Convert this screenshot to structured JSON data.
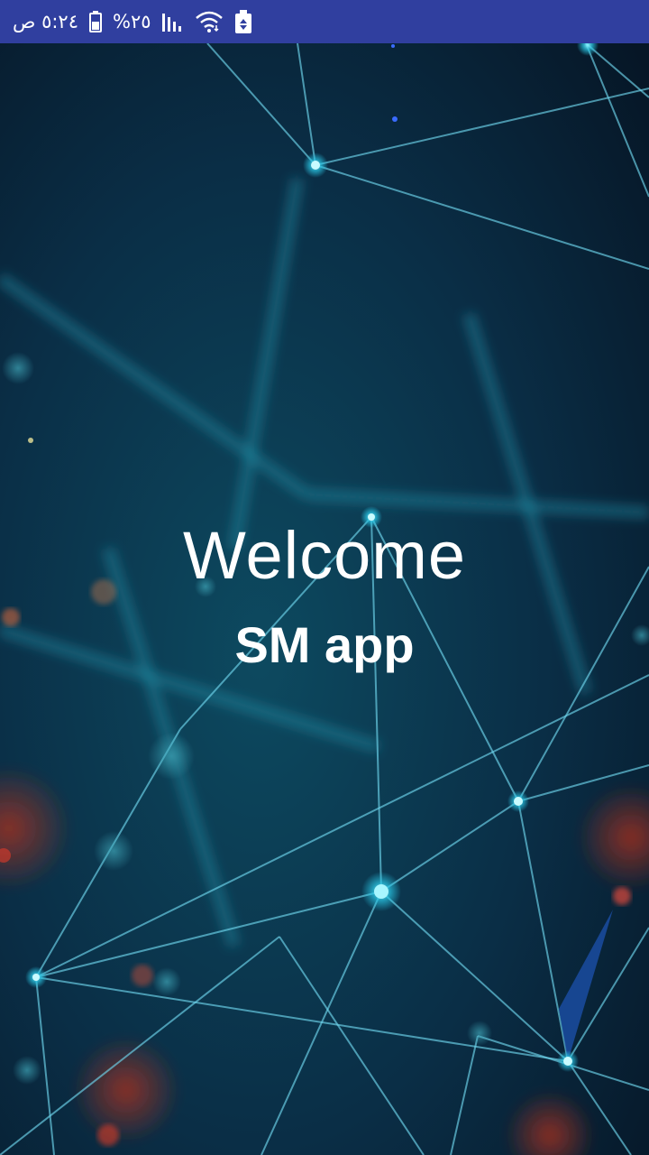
{
  "status_bar": {
    "time": "٥:٢٤ ص",
    "battery_percent": "%٢٥",
    "battery_icon": "battery-icon",
    "signal_icon": "signal-icon",
    "wifi_icon": "wifi-icon",
    "notification_icon": "recycle-notification-icon",
    "background_color": "#303f9f"
  },
  "splash": {
    "welcome": "Welcome",
    "app_name": "SM app",
    "background_image": "network-lines-background",
    "text_color": "#ffffff"
  }
}
